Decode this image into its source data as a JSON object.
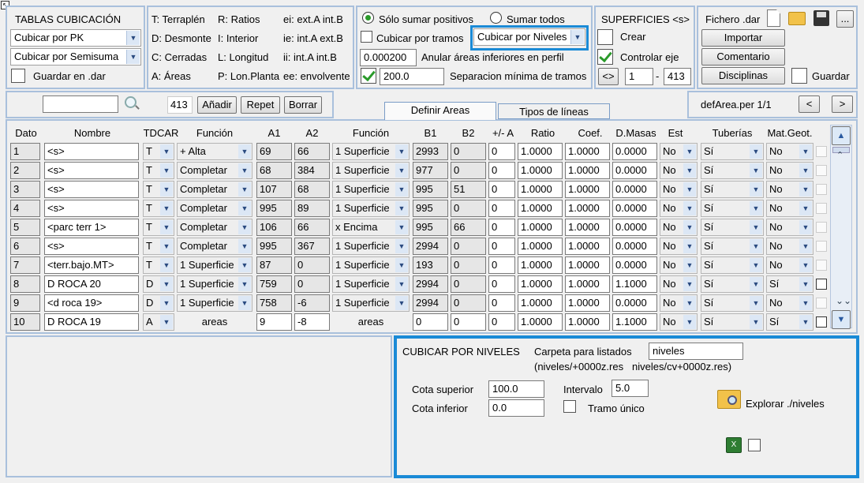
{
  "tablas": {
    "title": "TABLAS CUBICACIÓN",
    "combo1": "Cubicar por PK",
    "combo2": "Cubicar por Semisuma",
    "guardar_dar": "Guardar en .dar"
  },
  "legend": {
    "col1": [
      "T: Terraplén",
      "D: Desmonte",
      "C: Cerradas",
      "A: Áreas"
    ],
    "col2": [
      "R: Ratios",
      "I: Interior",
      "L: Longitud",
      "P: Lon.Planta"
    ],
    "col3": [
      "ei: ext.A int.B",
      "ie: int.A ext.B",
      "ii: int.A int.B",
      "ee: envolvente"
    ]
  },
  "options": {
    "radio1": "Sólo sumar positivos",
    "radio2": "Sumar todos",
    "cubicar_tramos": "Cubicar por tramos",
    "method_combo": "Cubicar por Niveles",
    "anular_value": "0.000200",
    "anular_label": "Anular áreas inferiores en perfil",
    "sep_value": "200.0",
    "sep_label": "Separacion mínima de tramos"
  },
  "superficies": {
    "title": "SUPERFICIES <s>",
    "crear": "Crear",
    "controlar": "Controlar eje",
    "range_btn": "<>",
    "from": "1",
    "dash": "-",
    "to": "413"
  },
  "fichero": {
    "label": "Fichero .dar",
    "importar": "Importar",
    "comentario": "Comentario",
    "disciplinas": "Disciplinas",
    "guardar": "Guardar",
    "more": "..."
  },
  "toolbar": {
    "search_value": "",
    "count": "413",
    "anadir": "Añadir",
    "repet": "Repet",
    "borrar": "Borrar"
  },
  "tabs": [
    "Definir Areas",
    "Tipos de líneas"
  ],
  "file_nav": {
    "label": "defArea.per 1/1",
    "prev": "<",
    "next": ">"
  },
  "table": {
    "headers": [
      "Dato",
      "Nombre",
      "TDCAR",
      "Función",
      "A1",
      "A2",
      "Función",
      "B1",
      "B2",
      "+/- A",
      "Ratio",
      "Coef.",
      "D.Masas",
      "Est",
      "Tuberías",
      "Mat.Geot."
    ],
    "rows": [
      {
        "dato": "1",
        "nombre": "<s>",
        "td": "T",
        "fa": "+ Alta",
        "a1": "69",
        "a2": "66",
        "fb": "1 Superficie",
        "b1": "2993",
        "b2": "0",
        "pm": "0",
        "ratio": "1.0000",
        "coef": "1.0000",
        "dmas": "0.0000",
        "est": "No",
        "tub": "Sí",
        "mat": "No"
      },
      {
        "dato": "2",
        "nombre": "<s>",
        "td": "T",
        "fa": "Completar",
        "a1": "68",
        "a2": "384",
        "fb": "1 Superficie",
        "b1": "977",
        "b2": "0",
        "pm": "0",
        "ratio": "1.0000",
        "coef": "1.0000",
        "dmas": "0.0000",
        "est": "No",
        "tub": "Sí",
        "mat": "No"
      },
      {
        "dato": "3",
        "nombre": "<s>",
        "td": "T",
        "fa": "Completar",
        "a1": "107",
        "a2": "68",
        "fb": "1 Superficie",
        "b1": "995",
        "b2": "51",
        "pm": "0",
        "ratio": "1.0000",
        "coef": "1.0000",
        "dmas": "0.0000",
        "est": "No",
        "tub": "Sí",
        "mat": "No"
      },
      {
        "dato": "4",
        "nombre": "<s>",
        "td": "T",
        "fa": "Completar",
        "a1": "995",
        "a2": "89",
        "fb": "1 Superficie",
        "b1": "995",
        "b2": "0",
        "pm": "0",
        "ratio": "1.0000",
        "coef": "1.0000",
        "dmas": "0.0000",
        "est": "No",
        "tub": "Sí",
        "mat": "No"
      },
      {
        "dato": "5",
        "nombre": "<parc terr 1>",
        "td": "T",
        "fa": "Completar",
        "a1": "106",
        "a2": "66",
        "fb": "x Encima",
        "b1": "995",
        "b2": "66",
        "pm": "0",
        "ratio": "1.0000",
        "coef": "1.0000",
        "dmas": "0.0000",
        "est": "No",
        "tub": "Sí",
        "mat": "No"
      },
      {
        "dato": "6",
        "nombre": "<s>",
        "td": "T",
        "fa": "Completar",
        "a1": "995",
        "a2": "367",
        "fb": "1 Superficie",
        "b1": "2994",
        "b2": "0",
        "pm": "0",
        "ratio": "1.0000",
        "coef": "1.0000",
        "dmas": "0.0000",
        "est": "No",
        "tub": "Sí",
        "mat": "No"
      },
      {
        "dato": "7",
        "nombre": "<terr.bajo.MT>",
        "td": "T",
        "fa": "1 Superficie",
        "a1": "87",
        "a2": "0",
        "fb": "1 Superficie",
        "b1": "193",
        "b2": "0",
        "pm": "0",
        "ratio": "1.0000",
        "coef": "1.0000",
        "dmas": "0.0000",
        "est": "No",
        "tub": "Sí",
        "mat": "No"
      },
      {
        "dato": "8",
        "nombre": "D ROCA 20",
        "td": "D",
        "fa": "1 Superficie",
        "a1": "759",
        "a2": "0",
        "fb": "1 Superficie",
        "b1": "2994",
        "b2": "0",
        "pm": "0",
        "ratio": "1.0000",
        "coef": "1.0000",
        "dmas": "1.1000",
        "est": "No",
        "tub": "Sí",
        "mat": "Sí"
      },
      {
        "dato": "9",
        "nombre": "<d roca 19>",
        "td": "D",
        "fa": "1 Superficie",
        "a1": "758",
        "a2": "-6",
        "fb": "1 Superficie",
        "b1": "2994",
        "b2": "0",
        "pm": "0",
        "ratio": "1.0000",
        "coef": "1.0000",
        "dmas": "0.0000",
        "est": "No",
        "tub": "Sí",
        "mat": "No"
      },
      {
        "dato": "10",
        "nombre": "D ROCA 19",
        "td": "A",
        "fa": "areas",
        "a1": "9",
        "a2": "-8",
        "fb": "areas",
        "b1": "0",
        "b2": "0",
        "pm": "0",
        "ratio": "1.0000",
        "coef": "1.0000",
        "dmas": "1.1000",
        "est": "No",
        "tub": "Sí",
        "mat": "Sí"
      }
    ]
  },
  "niveles": {
    "title": "CUBICAR POR NIVELES",
    "carpeta_label": "Carpeta para listados",
    "carpeta_value": "niveles",
    "path1": "(niveles/+0000z.res",
    "path2": "niveles/cv+0000z.res)",
    "cota_sup_label": "Cota superior",
    "cota_sup_value": "100.0",
    "cota_inf_label": "Cota inferior",
    "cota_inf_value": "0.0",
    "intervalo_label": "Intervalo",
    "intervalo_value": "5.0",
    "tramo_label": "Tramo único",
    "explorar": "Explorar ./niveles"
  },
  "colors": {
    "group_border": "#a9c0dc",
    "highlight": "#1a8ad6",
    "check_green": "#2a9a2a"
  }
}
